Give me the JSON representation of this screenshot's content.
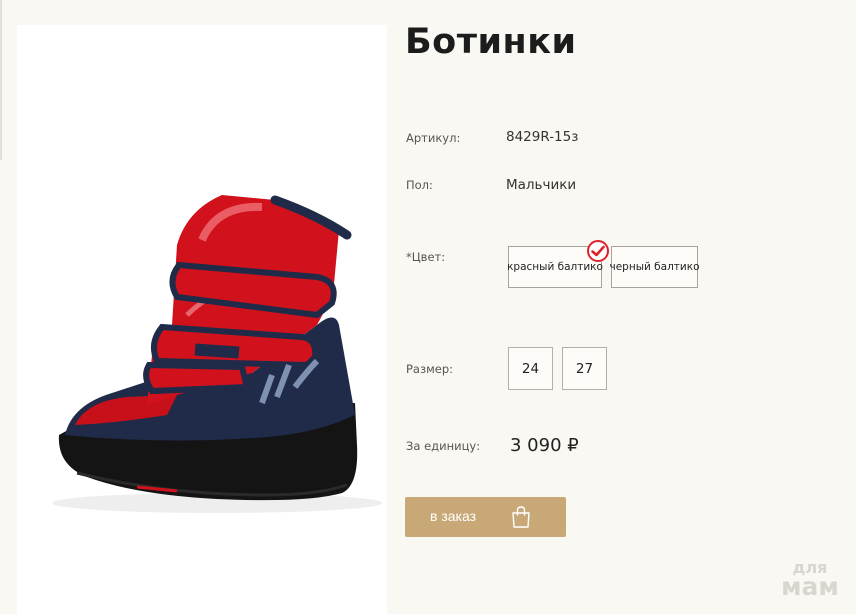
{
  "product": {
    "title": "Ботинки",
    "image_alt": "red and navy kids winter boot"
  },
  "attributes": {
    "article_label": "Артикул:",
    "article_value": "8429R-15з",
    "gender_label": "Пол:",
    "gender_value": "Мальчики",
    "color_label": "*Цвет:",
    "size_label": "Размер:",
    "price_label": "За единицу:"
  },
  "colors": [
    {
      "label": "красный балтико",
      "selected": true
    },
    {
      "label": "черный балтико",
      "selected": false
    }
  ],
  "sizes": [
    "24",
    "27"
  ],
  "price": "3 090 ₽",
  "order_button": {
    "label": "в заказ",
    "icon": "shopping-bag-icon"
  },
  "watermark": {
    "line1": "для",
    "line2": "мам"
  },
  "palette": {
    "background": "#faf8f2",
    "accent": "#c9a877",
    "check": "#e0212b",
    "boot_red": "#d1121c",
    "boot_navy": "#1f2b48"
  }
}
